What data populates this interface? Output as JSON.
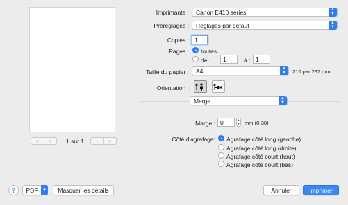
{
  "preview": {
    "page_indicator": "1 sur 1",
    "nav_first": "«",
    "nav_prev": "‹",
    "nav_next": "›",
    "nav_last": "»"
  },
  "printer": {
    "label": "Imprimante :",
    "value": "Canon E410 series"
  },
  "presets": {
    "label": "Préréglages :",
    "value": "Réglages par défaut"
  },
  "copies": {
    "label": "Copies :",
    "value": "1"
  },
  "pages": {
    "label": "Pages :",
    "all_label": "toutes",
    "range_label": "de :",
    "from": "1",
    "to_label": "à :",
    "to": "1",
    "selected": "all"
  },
  "paper_size": {
    "label": "Taille du papier :",
    "value": "A4",
    "dimensions": "210 par 297 mm"
  },
  "orientation": {
    "label": "Orientation :",
    "selected": "portrait"
  },
  "panel_select": {
    "value": "Marge"
  },
  "margin": {
    "label": "Marge :",
    "value": "0",
    "hint": "mm (0-30)"
  },
  "stapling": {
    "label": "Côté d'agrafage:",
    "options": [
      "Agrafage côté long (gauche)",
      "Agrafage côté long (droite)",
      "Agrafage côté court (haut)",
      "Agrafage côté court (bas)"
    ],
    "selected_index": 0
  },
  "footer": {
    "help": "?",
    "pdf": "PDF",
    "details": "Masquer les détails",
    "cancel": "Annuler",
    "print": "Imprimer"
  },
  "colors": {
    "accent": "#2f7cf6",
    "primary_button": "#3a87f7",
    "background": "#ececec"
  }
}
